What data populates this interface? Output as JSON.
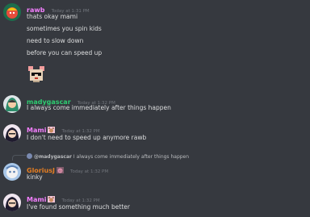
{
  "messages": [
    {
      "username": "rawb",
      "name_color": "#f47fff",
      "timestamp": "Today at 1:31 PM",
      "lines": [
        "thats okay mami",
        "sometimes you spin kids",
        "need to slow down",
        "before you can speed up"
      ],
      "sticker": "pixel-mouse-sunglasses-sticker"
    },
    {
      "username": "madygascar",
      "name_color": "#2ecc71",
      "timestamp": "Today at 1:32 PM",
      "lines": [
        "I always come immediately after things happen"
      ]
    },
    {
      "username": "Mami",
      "name_color": "#f47fff",
      "badge": "cat-icon",
      "timestamp": "Today at 1:32 PM",
      "lines": [
        "I don't need to speed up anymore rawb"
      ]
    },
    {
      "reply": {
        "mention": "@madygascar",
        "text": "I always come immediately after things happen"
      },
      "username": "GloriusJ",
      "name_color": "#e67e22",
      "badge": "pig-icon",
      "timestamp": "Today at 1:32 PM",
      "lines": [
        "kinky"
      ]
    },
    {
      "username": "Mami",
      "name_color": "#f47fff",
      "badge": "cat-icon",
      "timestamp": "Today at 1:32 PM",
      "lines": [
        "I've found something much better"
      ]
    }
  ],
  "colors": {
    "background": "#36393f",
    "text": "#dcddde",
    "timestamp": "#72767d"
  }
}
